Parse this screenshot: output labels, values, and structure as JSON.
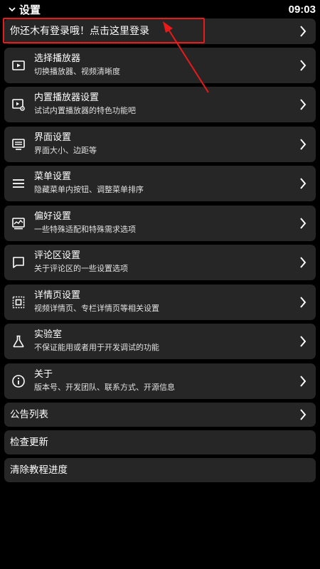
{
  "header": {
    "title": "设置",
    "clock": "09:03"
  },
  "login": {
    "label": "你还木有登录哦！点击这里登录"
  },
  "items": [
    {
      "title": "选择播放器",
      "subtitle": "切换播放器、视频清晰度",
      "icon": "play-box-icon"
    },
    {
      "title": "内置播放器设置",
      "subtitle": "试试内置播放器的特色功能吧",
      "icon": "player-settings-icon"
    },
    {
      "title": "界面设置",
      "subtitle": "界面大小、边距等",
      "icon": "screen-layout-icon"
    },
    {
      "title": "菜单设置",
      "subtitle": "隐藏菜单内按钮、调整菜单排序",
      "icon": "menu-lines-icon"
    },
    {
      "title": "偏好设置",
      "subtitle": "一些特殊适配和特殊需求选项",
      "icon": "preference-chart-icon"
    },
    {
      "title": "评论区设置",
      "subtitle": "关于评论区的一些设置选项",
      "icon": "comment-icon"
    },
    {
      "title": "详情页设置",
      "subtitle": "视频详情页、专栏详情页等相关设置",
      "icon": "detail-frame-icon"
    },
    {
      "title": "实验室",
      "subtitle": "不保证能用或者用于开发调试的功能",
      "icon": "flask-icon"
    },
    {
      "title": "关于",
      "subtitle": "版本号、开发团队、联系方式、开源信息",
      "icon": "info-icon"
    }
  ],
  "plain": [
    {
      "label": "公告列表",
      "has_chevron": true
    },
    {
      "label": "检查更新",
      "has_chevron": false
    },
    {
      "label": "清除教程进度",
      "has_chevron": false
    }
  ],
  "colors": {
    "background": "#000000",
    "card": "#262626",
    "highlight": "#e81a1a"
  }
}
